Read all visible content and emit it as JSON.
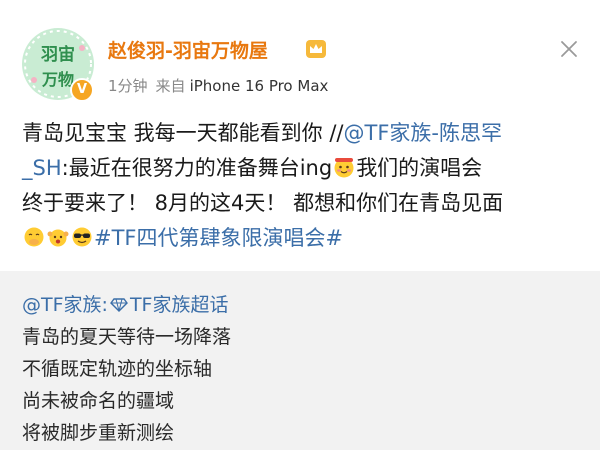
{
  "post": {
    "author": {
      "avatar_text_top": "羽宙",
      "avatar_text_bottom": "万物",
      "name": "赵俊羽-羽宙万物屋",
      "time": "1分钟",
      "source_prefix": "来自",
      "source_device": "iPhone 16 Pro Max",
      "verified_icon": "v-badge-icon",
      "crown_icon": "crown-icon"
    },
    "body": {
      "l1_text": "青岛见宝宝 我每一天都能看到你 //",
      "l1_mention": "@TF家族-陈思罕",
      "l2_mention": "_SH",
      "l2_text": ":最近在很努力的准备舞台ing",
      "l2_after": "我们的演唱会",
      "l3_text": "终于要来了！ 8月的这4天！ 都想和你们在青岛见面",
      "hashtag": "#TF四代第肆象限演唱会#"
    }
  },
  "repost": {
    "mention": "@TF家族:",
    "supertopic": "TF家族超话",
    "lines": [
      "青岛的夏天等待一场降落",
      "不循既定轨迹的坐标轴",
      "尚未被命名的疆域",
      "将被脚步重新测绘"
    ]
  },
  "colors": {
    "username": "#e8780f",
    "link": "#3b6ea8",
    "repost_bg": "#f2f2f2",
    "avatar_bg": "#c9ecd3"
  }
}
